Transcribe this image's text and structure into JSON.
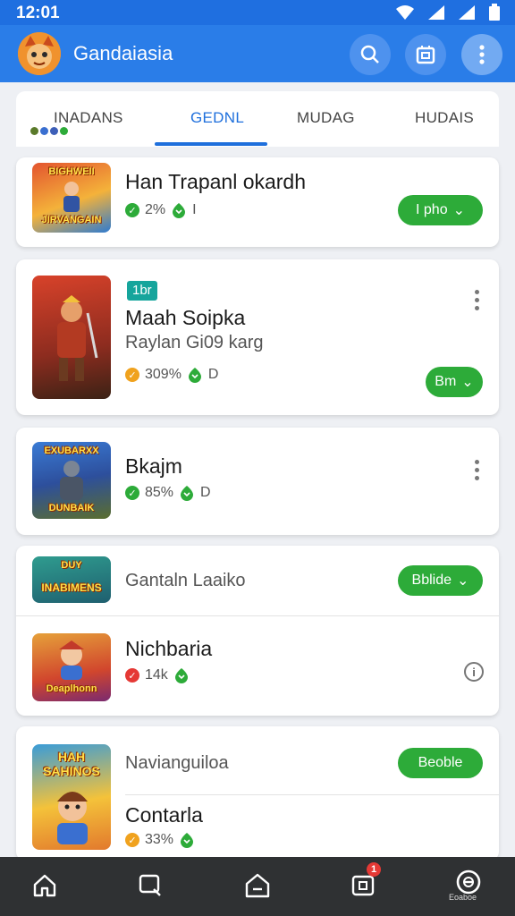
{
  "status_bar": {
    "time": "12:01",
    "colors": {
      "bg": "#1f6fe0"
    }
  },
  "app_bar": {
    "title": "Gandaiasia",
    "icons": [
      "search-icon",
      "calendar-icon",
      "more-vert-icon"
    ]
  },
  "tabs": [
    {
      "label": "INADANS",
      "active": false
    },
    {
      "label": "GEDNL",
      "active": true
    },
    {
      "label": "MUDAG",
      "active": false
    },
    {
      "label": "HUDAIS",
      "active": false
    }
  ],
  "cards": [
    {
      "thumb_text": "BIGHWEII",
      "thumb_text_bottom": "JIRVANGAIN",
      "title": "Han Trapanl okardh",
      "stat1": "2%",
      "stat2": "I",
      "button": "I pho"
    },
    {
      "badge": "1br",
      "title": "Maah Soipka",
      "subtitle": "Raylan Gi09 karg",
      "stat1": "309%",
      "stat2": "D",
      "button": "Bm"
    },
    {
      "thumb_text": "EXUBARXX",
      "thumb_text_bottom": "DUNBAIK",
      "title": "Bkajm",
      "stat1": "85%",
      "stat2": "D"
    },
    {
      "thumb_text": "DUY",
      "thumb_text_bottom": "INABIMENS",
      "title": "Gantaln Laaiko",
      "button": "Bblide"
    },
    {
      "thumb_text_bottom": "Deaplhonn",
      "title": "Nichbaria",
      "stat1": "14k",
      "stat2": ""
    },
    {
      "thumb_text": "HAH",
      "thumb_text_bottom": "SAHINOS",
      "title": "Navianguiloa",
      "button": "Beoble",
      "title2": "Contarla",
      "stat1": "33%",
      "stat2": ""
    }
  ],
  "bottom_nav": {
    "items": [
      "home-icon",
      "chat-search-icon",
      "store-icon",
      "downloads-icon",
      "profile-icon"
    ],
    "badge": "1",
    "profile_label": "Eoaboe"
  },
  "colors": {
    "accent": "#2a7de8",
    "button_green": "#2dab39"
  }
}
